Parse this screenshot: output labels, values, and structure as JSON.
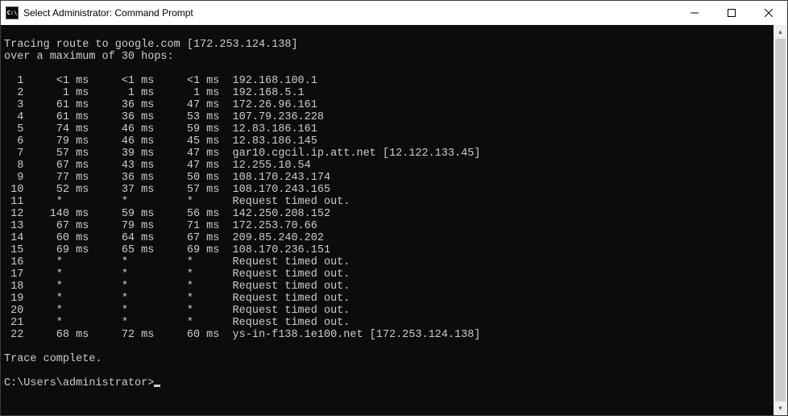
{
  "window": {
    "title": "Select Administrator: Command Prompt",
    "icon_text": "C:\\"
  },
  "headerLine1": "Tracing route to google.com [172.253.124.138]",
  "headerLine2": "over a maximum of 30 hops:",
  "hops": [
    {
      "n": 1,
      "t1": "<1 ms",
      "t2": "<1 ms",
      "t3": "<1 ms",
      "host": "192.168.100.1"
    },
    {
      "n": 2,
      "t1": "1 ms",
      "t2": "1 ms",
      "t3": "1 ms",
      "host": "192.168.5.1"
    },
    {
      "n": 3,
      "t1": "61 ms",
      "t2": "36 ms",
      "t3": "47 ms",
      "host": "172.26.96.161"
    },
    {
      "n": 4,
      "t1": "61 ms",
      "t2": "36 ms",
      "t3": "53 ms",
      "host": "107.79.236.228"
    },
    {
      "n": 5,
      "t1": "74 ms",
      "t2": "46 ms",
      "t3": "59 ms",
      "host": "12.83.186.161"
    },
    {
      "n": 6,
      "t1": "79 ms",
      "t2": "46 ms",
      "t3": "45 ms",
      "host": "12.83.186.145"
    },
    {
      "n": 7,
      "t1": "57 ms",
      "t2": "39 ms",
      "t3": "47 ms",
      "host": "gar10.cgcil.ip.att.net [12.122.133.45]"
    },
    {
      "n": 8,
      "t1": "67 ms",
      "t2": "43 ms",
      "t3": "47 ms",
      "host": "12.255.10.54"
    },
    {
      "n": 9,
      "t1": "77 ms",
      "t2": "36 ms",
      "t3": "50 ms",
      "host": "108.170.243.174"
    },
    {
      "n": 10,
      "t1": "52 ms",
      "t2": "37 ms",
      "t3": "57 ms",
      "host": "108.170.243.165"
    },
    {
      "n": 11,
      "t1": "*",
      "t2": "*",
      "t3": "*",
      "host": "Request timed out."
    },
    {
      "n": 12,
      "t1": "140 ms",
      "t2": "59 ms",
      "t3": "56 ms",
      "host": "142.250.208.152"
    },
    {
      "n": 13,
      "t1": "67 ms",
      "t2": "79 ms",
      "t3": "71 ms",
      "host": "172.253.70.66"
    },
    {
      "n": 14,
      "t1": "60 ms",
      "t2": "64 ms",
      "t3": "67 ms",
      "host": "209.85.240.202"
    },
    {
      "n": 15,
      "t1": "69 ms",
      "t2": "65 ms",
      "t3": "69 ms",
      "host": "108.170.236.151"
    },
    {
      "n": 16,
      "t1": "*",
      "t2": "*",
      "t3": "*",
      "host": "Request timed out."
    },
    {
      "n": 17,
      "t1": "*",
      "t2": "*",
      "t3": "*",
      "host": "Request timed out."
    },
    {
      "n": 18,
      "t1": "*",
      "t2": "*",
      "t3": "*",
      "host": "Request timed out."
    },
    {
      "n": 19,
      "t1": "*",
      "t2": "*",
      "t3": "*",
      "host": "Request timed out."
    },
    {
      "n": 20,
      "t1": "*",
      "t2": "*",
      "t3": "*",
      "host": "Request timed out."
    },
    {
      "n": 21,
      "t1": "*",
      "t2": "*",
      "t3": "*",
      "host": "Request timed out."
    },
    {
      "n": 22,
      "t1": "68 ms",
      "t2": "72 ms",
      "t3": "60 ms",
      "host": "ys-in-f138.1e100.net [172.253.124.138]"
    }
  ],
  "footerLine": "Trace complete.",
  "prompt": "C:\\Users\\administrator>"
}
